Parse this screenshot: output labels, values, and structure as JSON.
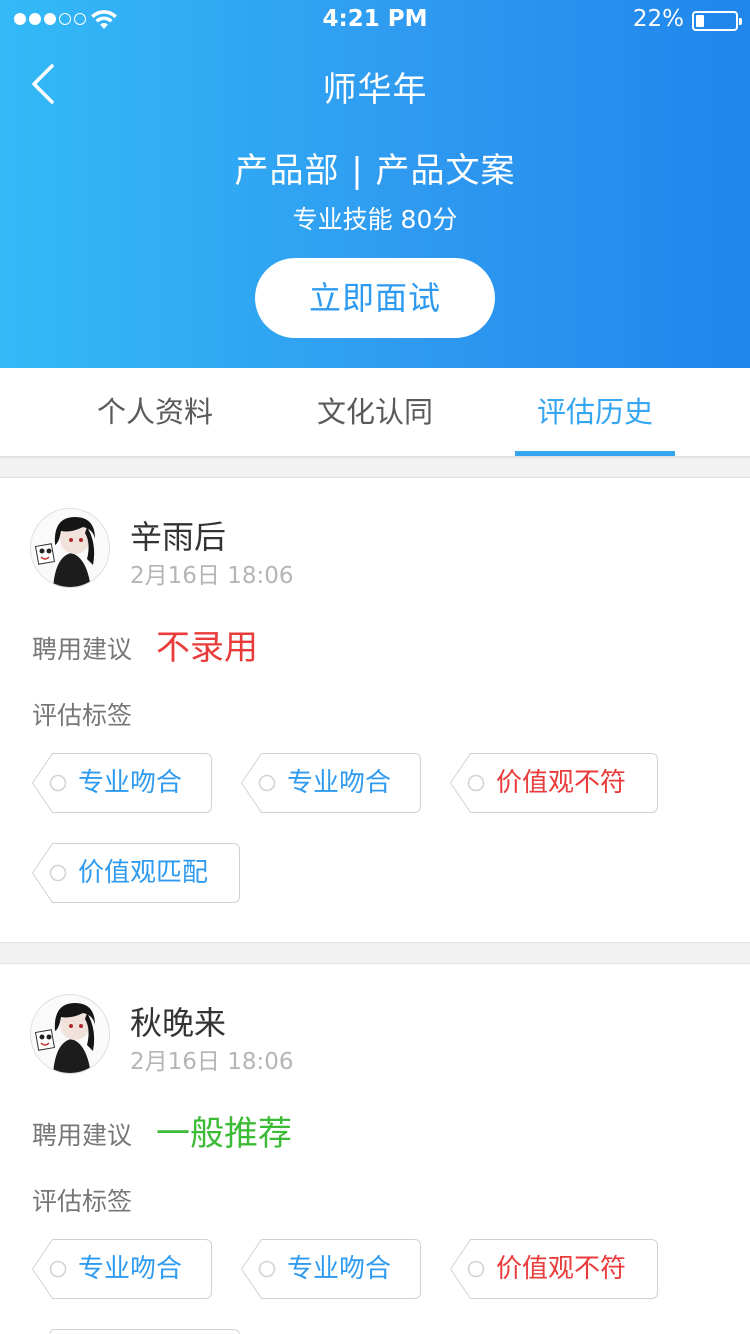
{
  "status_bar": {
    "time": "4:21 PM",
    "battery": "22%",
    "signal_filled": 3,
    "signal_total": 5,
    "battery_level": 0.22
  },
  "nav": {
    "back_icon": "chevron-left-icon",
    "title": "师华年"
  },
  "profile": {
    "department_role": "产品部 | 产品文案",
    "skill": "专业技能 80分",
    "interview_button": "立即面试"
  },
  "tabs": [
    {
      "label": "个人资料",
      "active": false
    },
    {
      "label": "文化认同",
      "active": false
    },
    {
      "label": "评估历史",
      "active": true
    }
  ],
  "evaluations": [
    {
      "name": "辛雨后",
      "date": "2月16日 18:06",
      "hire_label": "聘用建议",
      "verdict": "不录用",
      "verdict_color": "#ea3b3b",
      "tags_label": "评估标签",
      "tags": [
        {
          "text": "专业吻合",
          "color": "#2f9bf0"
        },
        {
          "text": "专业吻合",
          "color": "#2f9bf0"
        },
        {
          "text": "价值观不符",
          "color": "#ea3b3b"
        },
        {
          "text": "价值观匹配",
          "color": "#2f9bf0"
        }
      ]
    },
    {
      "name": "秋晚来",
      "date": "2月16日 18:06",
      "hire_label": "聘用建议",
      "verdict": "一般推荐",
      "verdict_color": "#3cbb36",
      "tags_label": "评估标签",
      "tags": [
        {
          "text": "专业吻合",
          "color": "#2f9bf0"
        },
        {
          "text": "专业吻合",
          "color": "#2f9bf0"
        },
        {
          "text": "价值观不符",
          "color": "#ea3b3b"
        }
      ]
    }
  ],
  "colors": {
    "accent": "#2f9bf0",
    "header_gradient_start": "#33baf7",
    "header_gradient_end": "#1f86ec",
    "negative": "#ea3b3b",
    "positive": "#3cbb36"
  }
}
